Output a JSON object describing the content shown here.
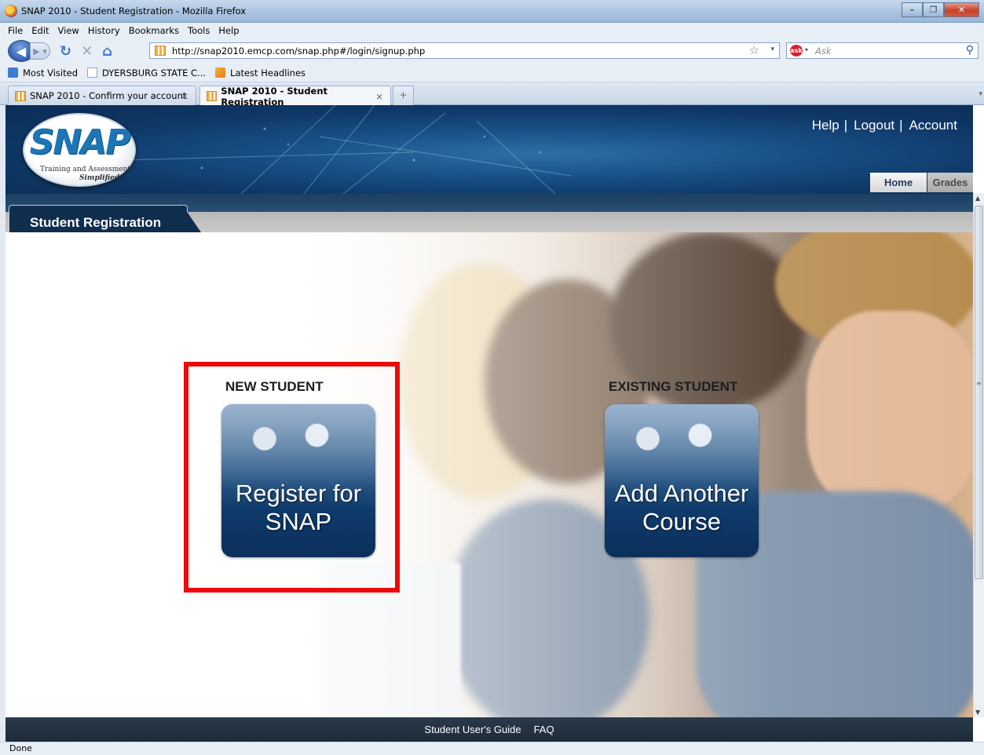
{
  "window": {
    "title": "SNAP 2010 - Student Registration - Mozilla Firefox"
  },
  "menu": [
    "File",
    "Edit",
    "View",
    "History",
    "Bookmarks",
    "Tools",
    "Help"
  ],
  "nav": {
    "url": "http://snap2010.emcp.com/snap.php#/login/signup.php",
    "search_placeholder": "Ask"
  },
  "bookmarks": [
    "Most Visited",
    "DYERSBURG STATE C...",
    "Latest Headlines"
  ],
  "tabs": [
    {
      "label": "SNAP 2010 - Confirm your account",
      "active": false
    },
    {
      "label": "SNAP 2010 - Student Registration",
      "active": true
    }
  ],
  "header": {
    "logo_text": "SNAP",
    "logo_tagline": "Training and Assessment",
    "logo_tagline2": "Simplified",
    "links": [
      "Help",
      "Logout",
      "Account"
    ],
    "nav_tabs": [
      "Home",
      "Grades"
    ]
  },
  "page": {
    "tab_label": "Student Registration",
    "new_student_heading": "NEW STUDENT",
    "new_student_button_line1": "Register for",
    "new_student_button_line2": "SNAP",
    "existing_student_heading": "EXISTING STUDENT",
    "existing_student_button_line1": "Add Another",
    "existing_student_button_line2": "Course"
  },
  "footer": {
    "links": [
      "Student User's Guide",
      "FAQ"
    ]
  },
  "status": "Done",
  "colors": {
    "highlight_box": "#ec0a0a",
    "header_blue": "#184f86",
    "card_blue": "#0e3a6b"
  }
}
